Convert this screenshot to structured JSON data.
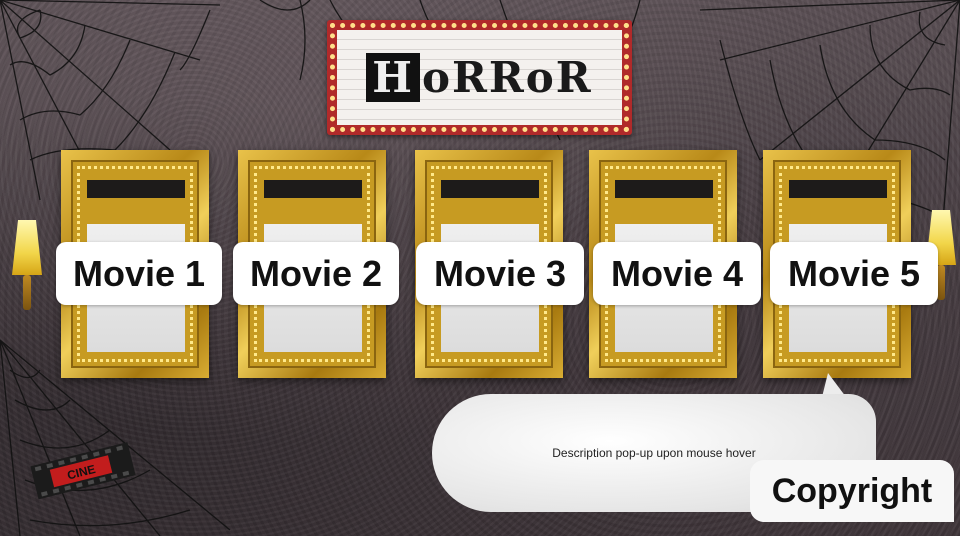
{
  "sign": {
    "title_first": "H",
    "title_rest": "oRRoR"
  },
  "movies": [
    {
      "label": "Movie 1"
    },
    {
      "label": "Movie 2"
    },
    {
      "label": "Movie 3"
    },
    {
      "label": "Movie 4"
    },
    {
      "label": "Movie 5"
    }
  ],
  "popup": {
    "text": "Description pop-up upon mouse hover"
  },
  "footer": {
    "copyright_label": "Copyright"
  },
  "logo": {
    "text": "CINE"
  },
  "colors": {
    "wall": "#4b4146",
    "frame_gold": "#c79b22",
    "sign_red": "#b02a2a",
    "label_bg": "#ffffff"
  }
}
